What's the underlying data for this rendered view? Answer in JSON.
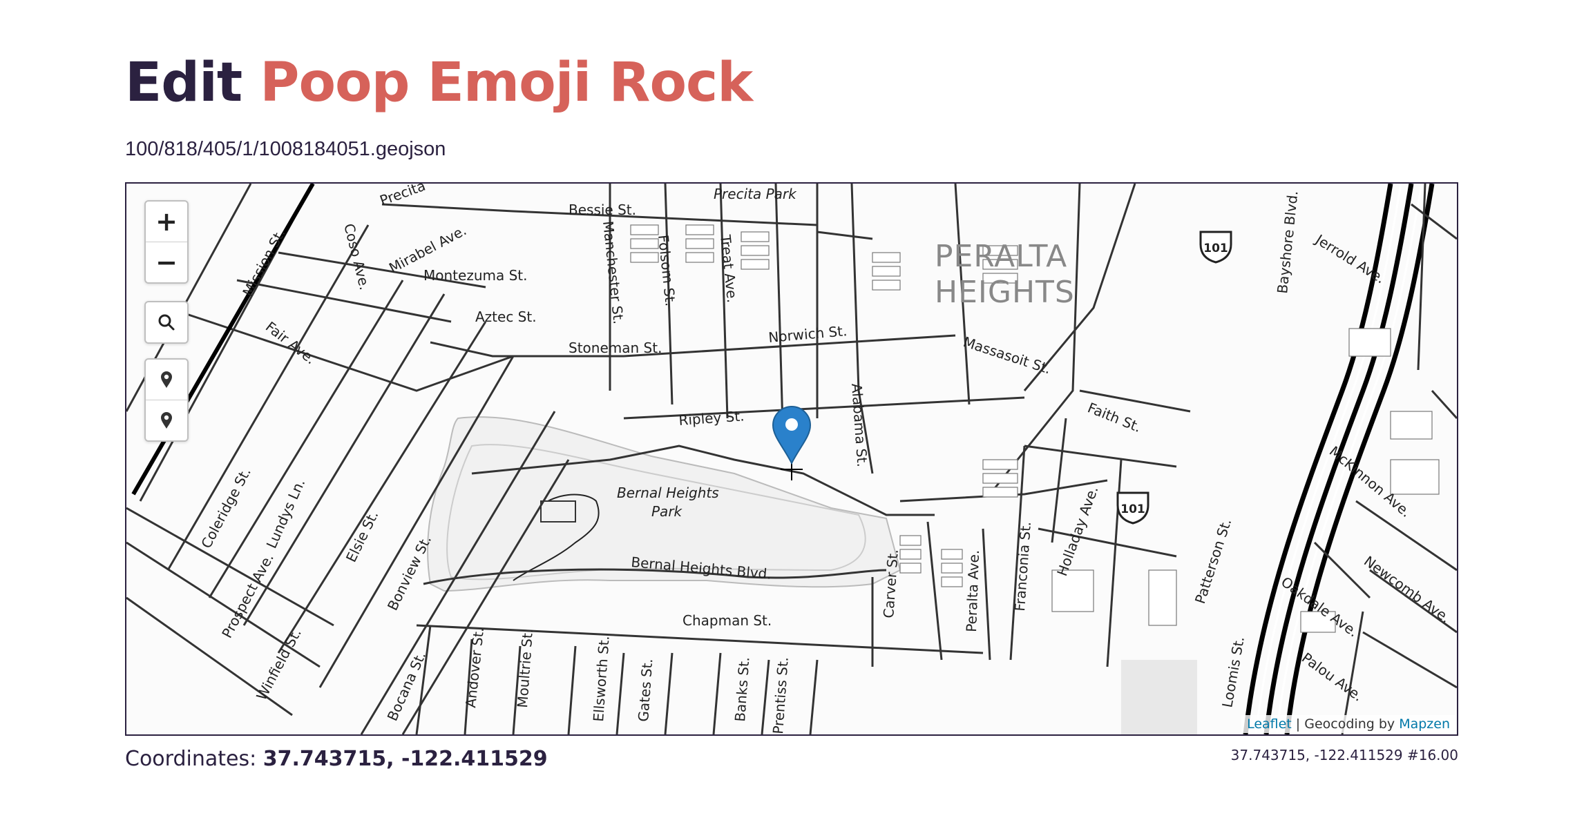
{
  "header": {
    "verb": "Edit",
    "name": "Poop Emoji Rock",
    "file_path": "100/818/405/1/1008184051.geojson"
  },
  "map": {
    "controls": {
      "zoom_in": "+",
      "zoom_out": "−",
      "search_icon": "search-icon",
      "marker_icons": [
        "map-marker-icon",
        "map-marker-icon"
      ]
    },
    "labels": {
      "neighborhood": [
        "PERALTA",
        "HEIGHTS"
      ],
      "park": [
        "Bernal Heights",
        "Park"
      ],
      "precita_park": "Precita Park",
      "highway_shield": "101",
      "streets": [
        "Bessie St.",
        "Montezuma St.",
        "Aztec St.",
        "Stoneman St.",
        "Mirabel Ave.",
        "Fair Ave.",
        "Mission St.",
        "Manchester St.",
        "Folsom St.",
        "Treat Ave.",
        "Norwich St.",
        "Alabama St.",
        "Ripley St.",
        "Massasoit St.",
        "Faith St.",
        "Jerrold Ave.",
        "Bayshore Blvd.",
        "McKinnon Ave.",
        "Newcomb Ave.",
        "Oakdale Ave.",
        "Palou Ave.",
        "Loomis St.",
        "Patterson St.",
        "Holladay Ave.",
        "Franconia St.",
        "Peralta Ave.",
        "Carver St.",
        "Bernal Heights Blvd.",
        "Chapman St.",
        "Coleridge St.",
        "Lundys Ln.",
        "Elsie St.",
        "Bonview St.",
        "Bocana St.",
        "Winfield St.",
        "Prospect Ave.",
        "Andover St.",
        "Moultrie St.",
        "Ellsworth St.",
        "Gates St.",
        "Banks St.",
        "Prentiss St.",
        "Coso Ave.",
        "Precita"
      ]
    },
    "attribution": {
      "leaflet": "Leaflet",
      "separator": " | Geocoding by ",
      "mapzen": "Mapzen"
    }
  },
  "footer": {
    "coords_label": "Coordinates: ",
    "coords_value": "37.743715, -122.411529",
    "map_hash": "37.743715, -122.411529 #16.00"
  },
  "colors": {
    "title_dark": "#2b2140",
    "title_accent": "#d6625a",
    "marker_blue": "#2a81cb",
    "link_blue": "#0078a8"
  }
}
